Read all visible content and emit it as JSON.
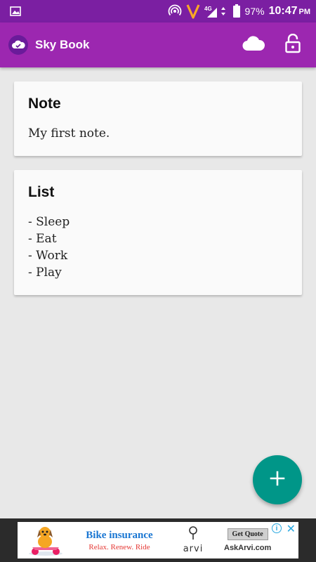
{
  "status_bar": {
    "icons": [
      "image-icon",
      "hotspot-icon",
      "vodafone-v-icon",
      "signal-4g-icon",
      "battery-icon"
    ],
    "network": "4G",
    "battery": "97%",
    "time": "10:47",
    "ampm": "PM"
  },
  "app_bar": {
    "title": "Sky Book",
    "actions": [
      "cloud-icon",
      "unlock-icon"
    ],
    "background": "#9c27b0"
  },
  "notes": [
    {
      "title": "Note",
      "body": "My first note."
    },
    {
      "title": "List",
      "body": "- Sleep\n- Eat\n- Work\n- Play"
    }
  ],
  "fab": {
    "icon": "plus-icon",
    "label": "+",
    "color": "#009688"
  },
  "ad": {
    "headline": "Bike insurance",
    "tagline": "Relax. Renew. Ride",
    "brand": "arvi",
    "cta": "Get Quote",
    "domain": "AskArvi.com",
    "info_icon": "i",
    "close_icon": "✕"
  }
}
